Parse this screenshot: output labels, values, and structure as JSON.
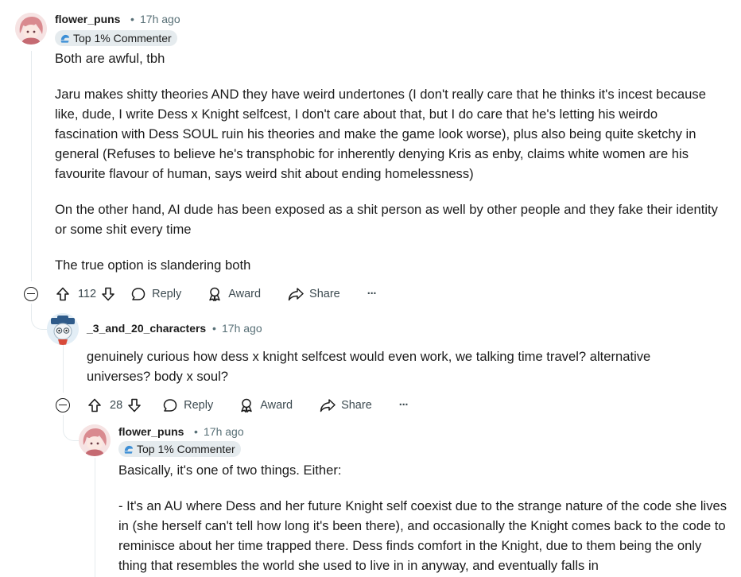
{
  "comments": [
    {
      "author": "flower_puns",
      "sep": "•",
      "time": "17h ago",
      "flair": "Top 1% Commenter",
      "paragraphs": [
        "Both are awful, tbh",
        "Jaru makes shitty theories AND they have weird undertones (I don't really care that he thinks it's incest because like, dude, I write Dess x Knight selfcest, I don't care about that, but I do care that he's letting his weirdo fascination with Dess SOUL ruin his theories and make the game look worse), plus also being quite sketchy in general (Refuses to believe he's transphobic for inherently denying Kris as enby, claims white women are his favourite flavour of human, says weird shit about ending homelessness)",
        "On the other hand, AI dude has been exposed as a shit person as well by other people and they fake their identity or some shit every time",
        "The true option is slandering both"
      ],
      "votes": "112",
      "reply": "Reply",
      "award": "Award",
      "share": "Share",
      "more": "···"
    },
    {
      "author": "_3_and_20_characters",
      "sep": "•",
      "time": "17h ago",
      "paragraphs": [
        "genuinely curious how dess x knight selfcest would even work, we talking time travel? alternative universes? body x soul?"
      ],
      "votes": "28",
      "reply": "Reply",
      "award": "Award",
      "share": "Share",
      "more": "···"
    },
    {
      "author": "flower_puns",
      "sep": "•",
      "time": "17h ago",
      "flair": "Top 1% Commenter",
      "paragraphs": [
        "Basically, it's one of two things. Either:",
        "- It's an AU where Dess and her future Knight self coexist due to the strange nature of the code she lives in (she herself can't tell how long it's been there), and occasionally the Knight comes back to the code to reminisce about her time trapped there. Dess finds comfort in the Knight, due to them being the only thing that resembles the world she used to live in in anyway, and eventually falls in"
      ]
    }
  ],
  "colors": {
    "text": "#1c1c1c",
    "meta": "#576f76",
    "flair_bg": "#e5ebee",
    "thread_line": "#e5ebee",
    "flair_icon": "#3d8fd6"
  }
}
